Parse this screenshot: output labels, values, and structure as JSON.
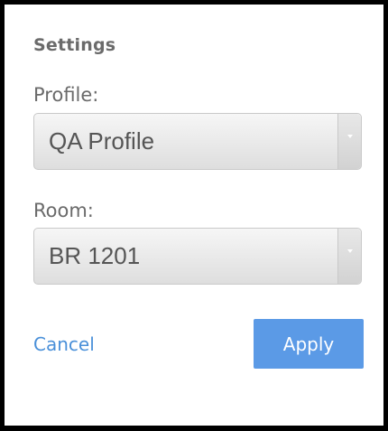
{
  "dialog": {
    "title": "Settings"
  },
  "profile": {
    "label": "Profile:",
    "selected": "QA Profile"
  },
  "room": {
    "label": "Room:",
    "selected": "BR 1201"
  },
  "actions": {
    "cancel_label": "Cancel",
    "apply_label": "Apply"
  },
  "colors": {
    "accent": "#5b9ae6",
    "link": "#4a90d9"
  }
}
